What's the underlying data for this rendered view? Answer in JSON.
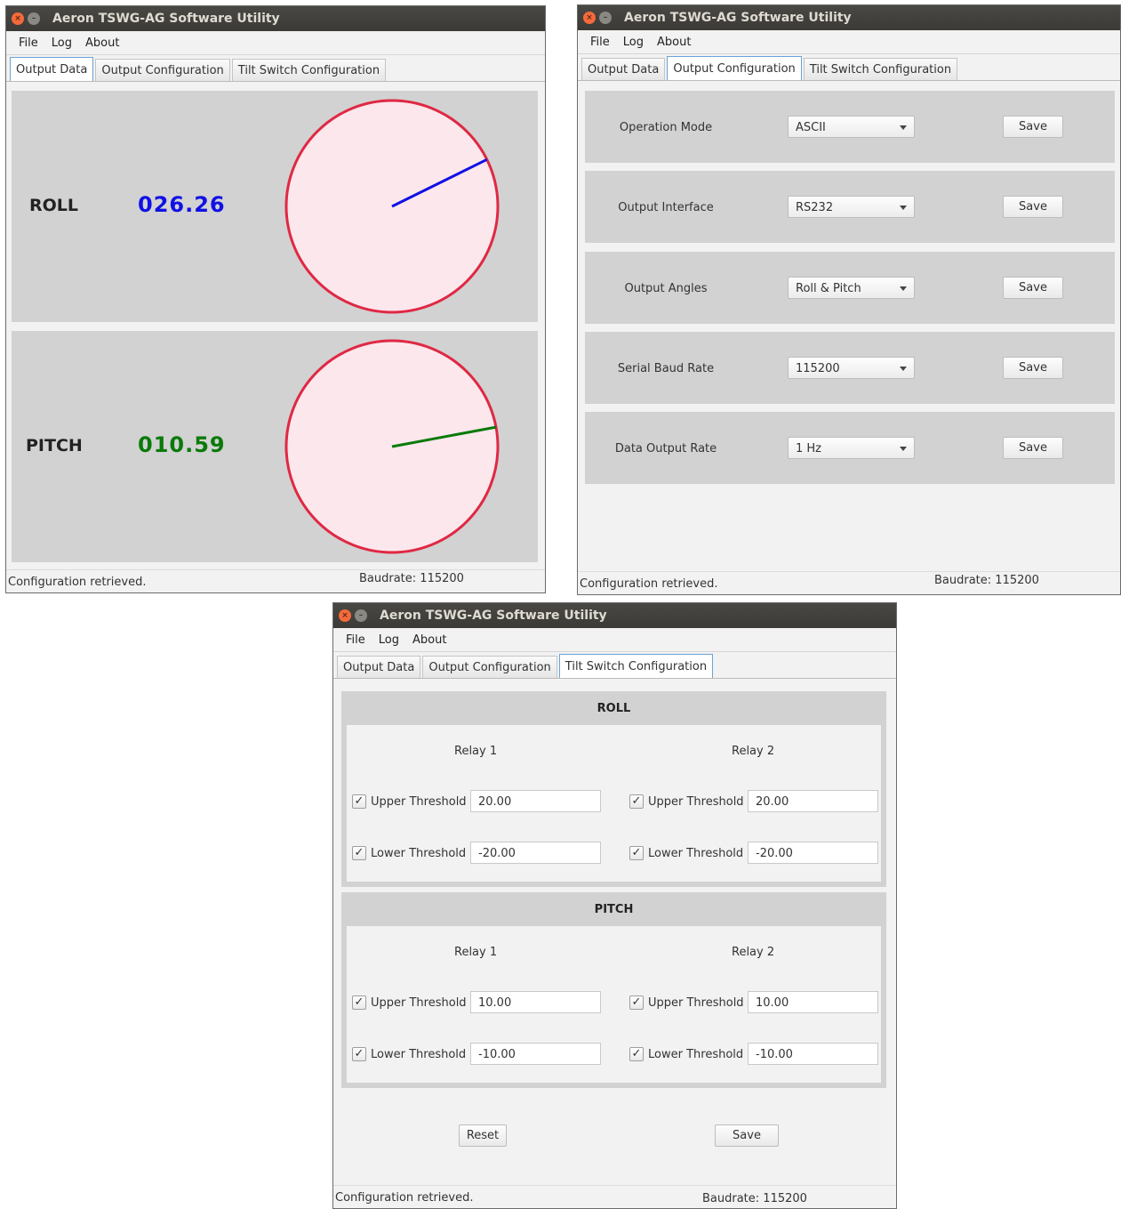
{
  "app": {
    "title": "Aeron TSWG-AG Software Utility",
    "menu": [
      "File",
      "Log",
      "About"
    ],
    "tabs": [
      "Output Data",
      "Output Configuration",
      "Tilt Switch Configuration"
    ],
    "status_message": "Configuration retrieved.",
    "baudrate_text": "Baudrate: 115200"
  },
  "output_data": {
    "roll": {
      "label": "ROLL",
      "value": "026.26",
      "color": "#1010e6",
      "angle_deg": 26.26
    },
    "pitch": {
      "label": "PITCH",
      "value": "010.59",
      "color": "#0a7a0a",
      "angle_deg": 10.59
    },
    "gauge": {
      "fill": "#fce8ec",
      "stroke": "#e02844"
    }
  },
  "output_configuration": {
    "rows": [
      {
        "label": "Operation Mode",
        "value": "ASCII",
        "save": "Save"
      },
      {
        "label": "Output Interface",
        "value": "RS232",
        "save": "Save"
      },
      {
        "label": "Output Angles",
        "value": "Roll & Pitch",
        "save": "Save"
      },
      {
        "label": "Serial Baud Rate",
        "value": "115200",
        "save": "Save"
      },
      {
        "label": "Data Output Rate",
        "value": "1 Hz",
        "save": "Save"
      }
    ]
  },
  "tilt_switch": {
    "roll": {
      "title": "ROLL",
      "relay1": {
        "header": "Relay 1",
        "upper_label": "Upper Threshold",
        "upper": "20.00",
        "lower_label": "Lower Threshold",
        "lower": "-20.00"
      },
      "relay2": {
        "header": "Relay 2",
        "upper_label": "Upper Threshold",
        "upper": "20.00",
        "lower_label": "Lower Threshold",
        "lower": "-20.00"
      }
    },
    "pitch": {
      "title": "PITCH",
      "relay1": {
        "header": "Relay 1",
        "upper_label": "Upper Threshold",
        "upper": "10.00",
        "lower_label": "Lower Threshold",
        "lower": "-10.00"
      },
      "relay2": {
        "header": "Relay 2",
        "upper_label": "Upper Threshold",
        "upper": "10.00",
        "lower_label": "Lower Threshold",
        "lower": "-10.00"
      }
    },
    "checkmark": "✓",
    "reset": "Reset",
    "save": "Save"
  }
}
